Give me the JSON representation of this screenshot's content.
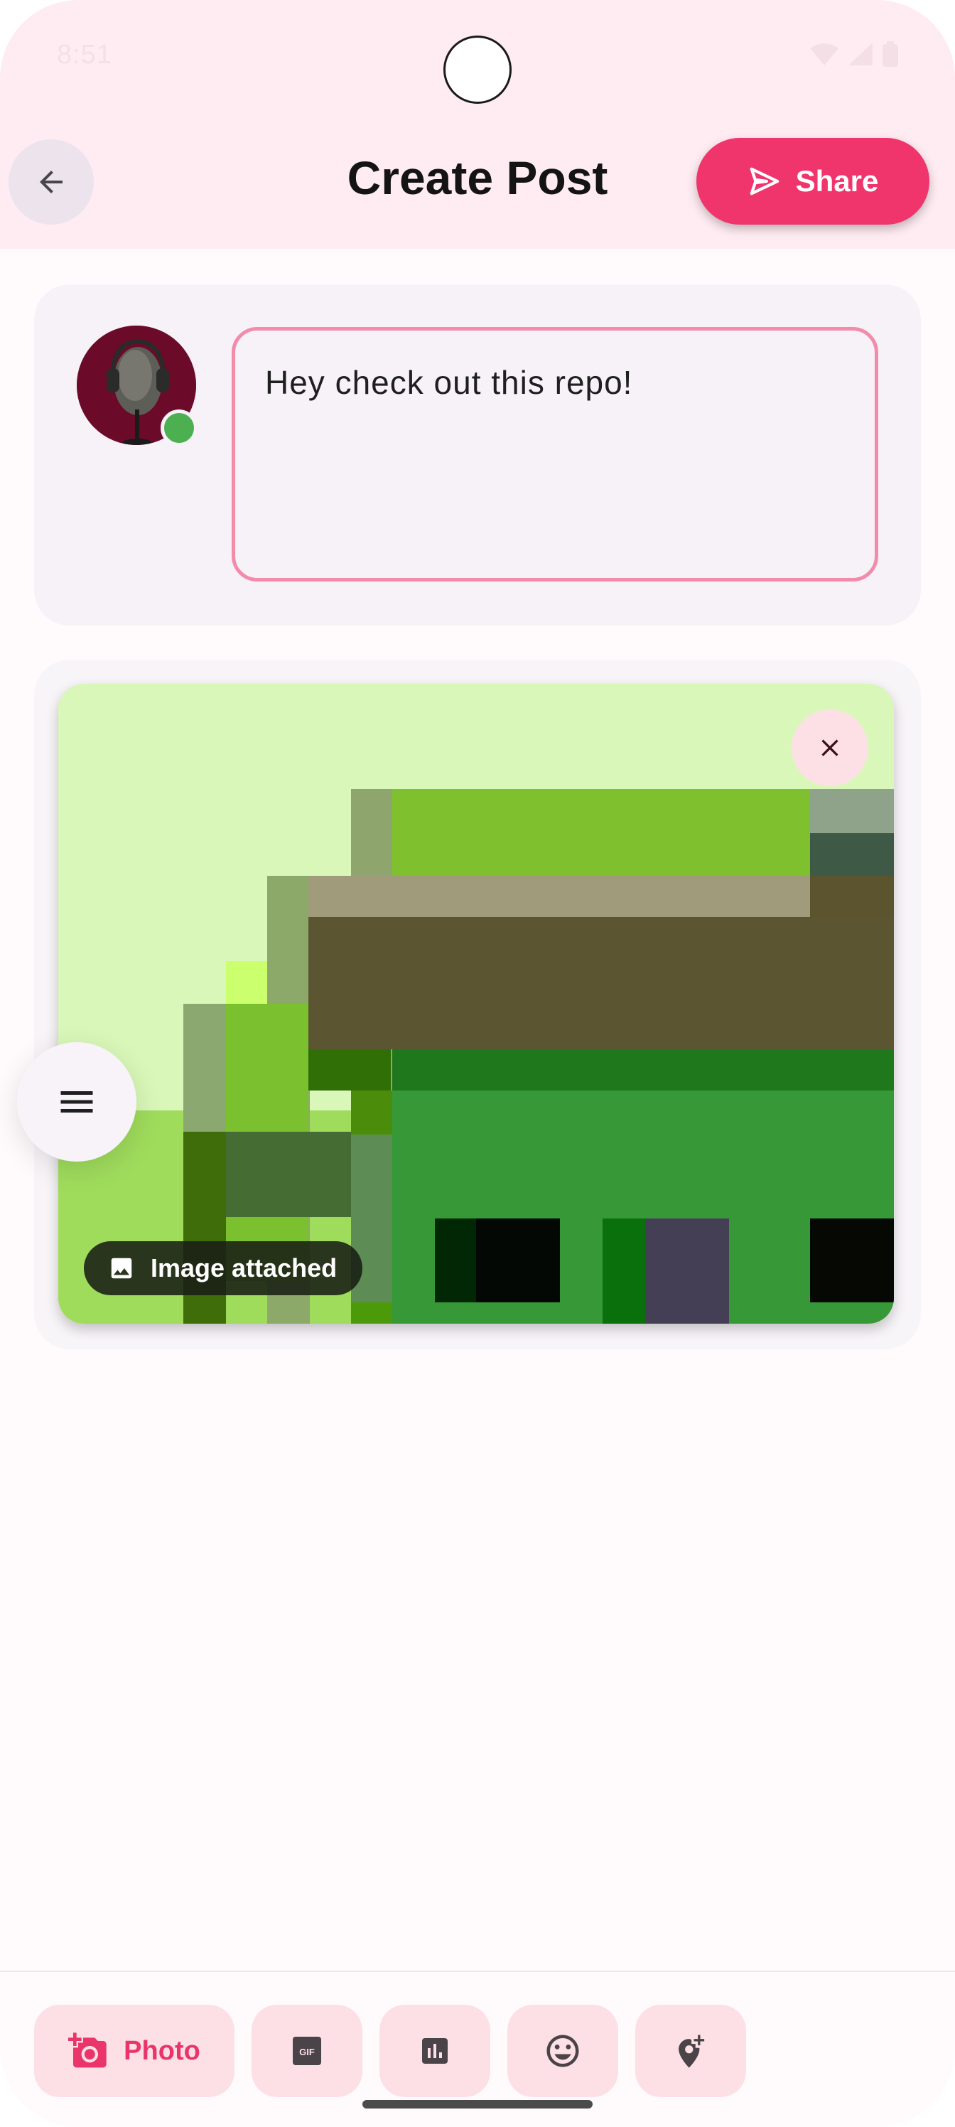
{
  "status_bar": {
    "time": "8:51"
  },
  "header": {
    "title": "Create Post",
    "back_icon": "arrow-back-icon",
    "share_label": "Share",
    "share_icon": "send-icon"
  },
  "composer": {
    "avatar": "headphones-mannequin-avatar",
    "post_text": "Hey check out this repo!",
    "online": true
  },
  "attachment": {
    "chip_label": "Image attached",
    "chip_icon": "image-icon",
    "remove_icon": "close-icon"
  },
  "toolbar": {
    "photo_label": "Photo",
    "items": [
      "add-photo-icon",
      "gif-icon",
      "poll-icon",
      "emoji-icon",
      "add-location-icon"
    ]
  },
  "colors": {
    "accent": "#f0356d",
    "app_bar": "#ffecf2",
    "chip_bg": "#fddfe6"
  }
}
